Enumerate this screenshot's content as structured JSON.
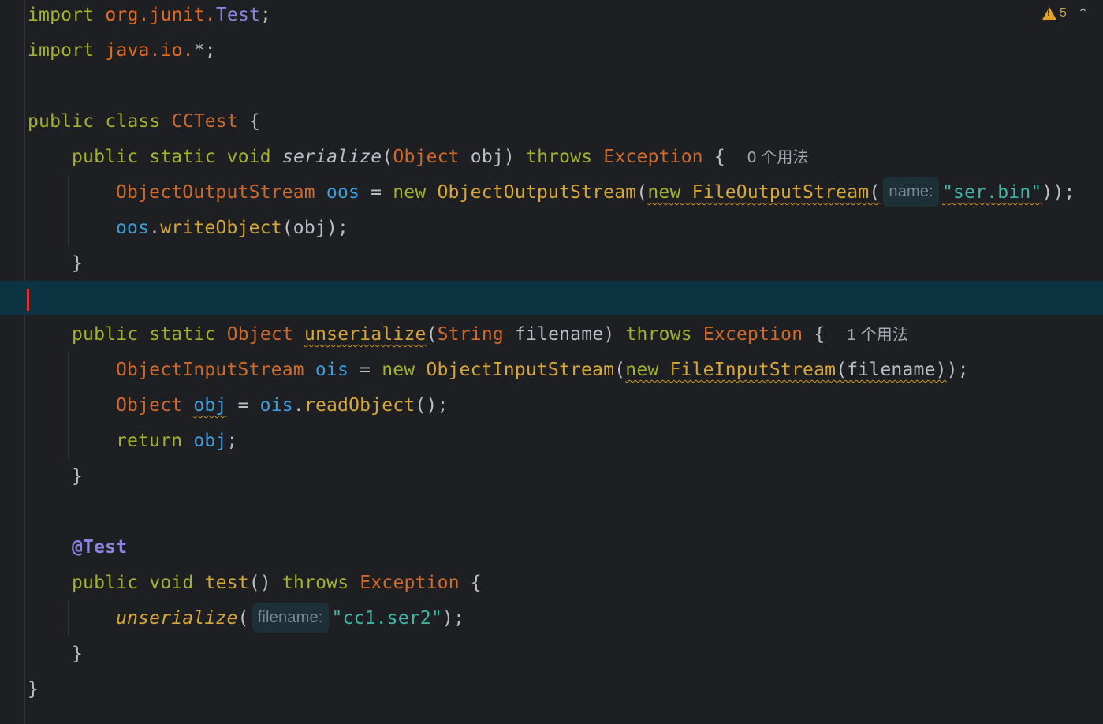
{
  "inspection_widget": {
    "warning_count": "5",
    "warning_icon": "warning-triangle-icon",
    "collapse_icon": "chevron-up-icon"
  },
  "code": {
    "l1": {
      "kw": "import",
      "pkg": "org.junit.",
      "cls": "Test",
      "end": ";"
    },
    "l2": {
      "kw": "import",
      "pkg": "java.io.",
      "rest": "*;"
    },
    "l4": {
      "kw": "public class",
      "cls": "CCTest",
      "end": " {"
    },
    "l5": {
      "kw1": "public static void",
      "mth": "serialize",
      "p1": "(",
      "cls1": "Object",
      "p2": " obj)",
      "kw2": "throws",
      "cls2": "Exception",
      "end": " {",
      "usage": "0 个用法"
    },
    "l6": {
      "cls1": "ObjectOutputStream",
      "fld": "oos",
      "eq": " = ",
      "kw": "new",
      "mth1": " ObjectOutputStream",
      "p1": "(",
      "w_kw": "new",
      "w_mth": " FileOutputStream",
      "p2": "(",
      "hint": "name:",
      "str": "\"ser.bin\"",
      "end": "));"
    },
    "l7": {
      "fld": "oos",
      "dot": ".",
      "mth": "writeObject",
      "end": "(obj);"
    },
    "l8": {
      "brace": "}"
    },
    "l10": {
      "kw1": "public static",
      "cls1": "Object",
      "mth": "unserialize",
      "p1": "(",
      "cls2": "String",
      "p2": " filename)",
      "kw2": "throws",
      "cls3": "Exception",
      "end": " {",
      "usage": "1 个用法"
    },
    "l11": {
      "cls1": "ObjectInputStream",
      "fld": "ois",
      "eq": " = ",
      "kw": "new",
      "mth1": " ObjectInputStream",
      "p1": "(",
      "w_kw": "new",
      "w_mth": " FileInputStream",
      "w_rest": "(filename)",
      "end": ");"
    },
    "l12": {
      "cls": "Object",
      "fld1": "obj",
      "eq": " = ",
      "fld2": "ois",
      "dot": ".",
      "mth": "readObject",
      "end": "();"
    },
    "l13": {
      "kw": "return",
      "fld": "obj",
      "end": ";"
    },
    "l14": {
      "brace": "}"
    },
    "l16": {
      "ann": "@Test"
    },
    "l17": {
      "kw1": "public void",
      "mth": "test",
      "p1": "()",
      "kw2": "throws",
      "cls": "Exception",
      "end": " {"
    },
    "l18": {
      "mth": "unserialize",
      "p1": "(",
      "hint": "filename:",
      "str": "\"cc1.ser2\"",
      "end": ");"
    },
    "l19": {
      "brace": "}"
    },
    "l20": {
      "brace": "}"
    }
  },
  "colors": {
    "background": "#1e1f22",
    "current_line": "#0b3341",
    "caret": "#e0312f",
    "keyword": "#a3b02e",
    "class": "#d06a2c",
    "field": "#3b9ede",
    "method": "#d6a638",
    "string": "#3fb6a8",
    "annotation": "#8d84e0"
  }
}
